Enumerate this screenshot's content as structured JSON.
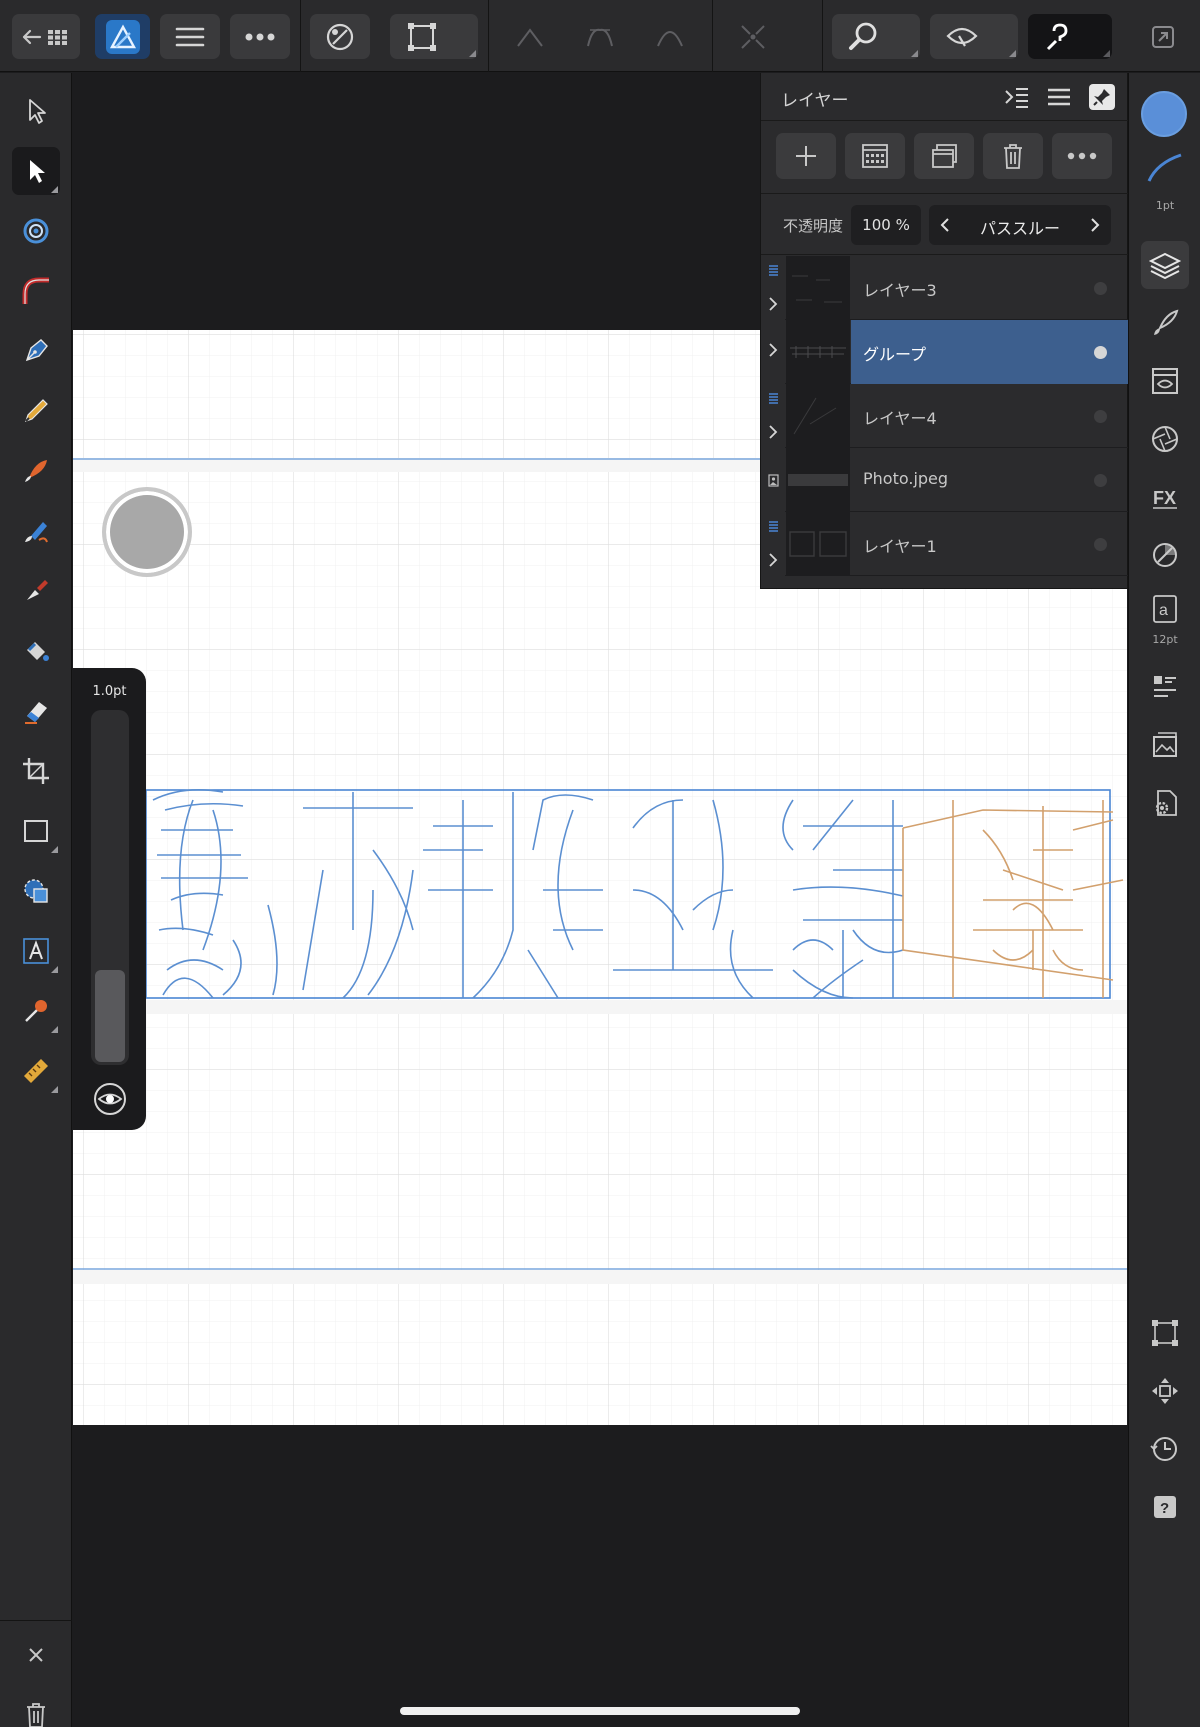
{
  "app": {
    "name": "Affinity Designer",
    "accent_color": "#3d5f8e",
    "selection_color": "#5a8fd8"
  },
  "toolbar": {
    "back_icon": "back-grid-icon",
    "persona_icon": "designer-persona-icon",
    "menu_icon": "hamburger-icon",
    "more_icon": "more-dots-icon",
    "snapping_icon": "snapping-magnet-icon",
    "transform_icon": "transform-box-icon",
    "node_icons": [
      "sharp-node-icon",
      "smooth-node-icon",
      "smart-node-icon"
    ],
    "break_icon": "break-curve-icon",
    "zoom_icon": "zoom-icon",
    "view_icon": "view-mode-icon",
    "help_icon": "quick-help-icon",
    "window_icon": "fullscreen-icon"
  },
  "left_tools": [
    {
      "name": "move-tool",
      "icon": "move-arrow-icon"
    },
    {
      "name": "node-tool",
      "icon": "node-arrow-icon",
      "active": true
    },
    {
      "name": "point-transform-tool",
      "icon": "target-icon"
    },
    {
      "name": "corner-tool",
      "icon": "corner-icon"
    },
    {
      "name": "pen-tool",
      "icon": "pen-icon"
    },
    {
      "name": "pencil-tool",
      "icon": "pencil-icon"
    },
    {
      "name": "vector-brush-tool",
      "icon": "brush-icon"
    },
    {
      "name": "fill-tool",
      "icon": "fill-icon"
    },
    {
      "name": "knife-tool",
      "icon": "knife-icon"
    },
    {
      "name": "paint-tool",
      "icon": "paint-bucket-icon"
    },
    {
      "name": "eraser-tool",
      "icon": "eraser-icon"
    },
    {
      "name": "crop-tool",
      "icon": "crop-icon"
    },
    {
      "name": "rectangle-tool",
      "icon": "rectangle-icon"
    },
    {
      "name": "shape-tool",
      "icon": "shape-icon"
    },
    {
      "name": "text-tool",
      "icon": "text-a-icon"
    },
    {
      "name": "color-picker-tool",
      "icon": "eyedropper-icon"
    },
    {
      "name": "measure-tool",
      "icon": "ruler-icon"
    }
  ],
  "left_bottom": {
    "close_icon": "close-x-icon",
    "delete_icon": "trash-icon"
  },
  "pressure": {
    "value": "1.0pt",
    "level": 0.26
  },
  "right_bar": {
    "stroke_size": "1pt",
    "text_size": "12pt",
    "fill_color": "#5a8fd8"
  },
  "layers_panel": {
    "title": "レイヤー",
    "opacity_label": "不透明度",
    "opacity_value": "100 %",
    "blend_mode": "パススルー",
    "layers": [
      {
        "name": "レイヤー3",
        "type": "layer",
        "expandable": true,
        "selected": false
      },
      {
        "name": "グループ",
        "type": "group",
        "expandable": true,
        "selected": true
      },
      {
        "name": "レイヤー4",
        "type": "layer",
        "expandable": true,
        "selected": false
      },
      {
        "name": "Photo.jpeg",
        "type": "image",
        "expandable": false,
        "selected": false
      },
      {
        "name": "レイヤー1",
        "type": "layer",
        "expandable": true,
        "selected": false
      }
    ]
  }
}
